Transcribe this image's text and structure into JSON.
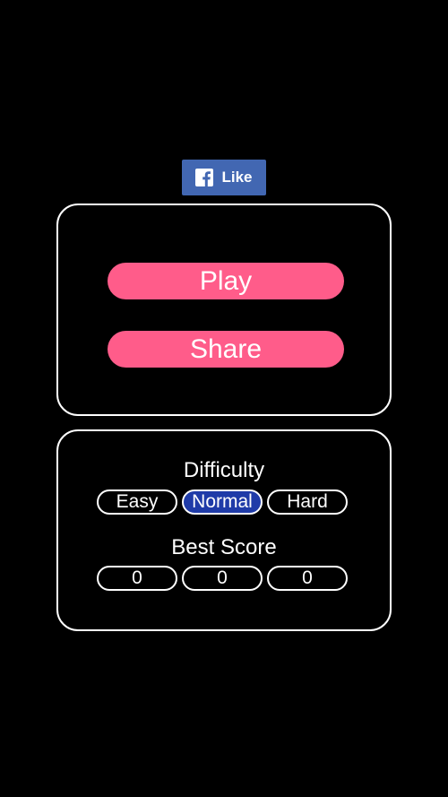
{
  "social": {
    "like_label": "Like",
    "brand_color": "#4267b2"
  },
  "menu": {
    "play_label": "Play",
    "share_label": "Share",
    "button_color": "#ff5c8a"
  },
  "difficulty": {
    "title": "Difficulty",
    "options": [
      "Easy",
      "Normal",
      "Hard"
    ],
    "selected": "Normal",
    "selected_color": "#1f3ba8"
  },
  "best_score": {
    "title": "Best Score",
    "values": [
      "0",
      "0",
      "0"
    ]
  }
}
